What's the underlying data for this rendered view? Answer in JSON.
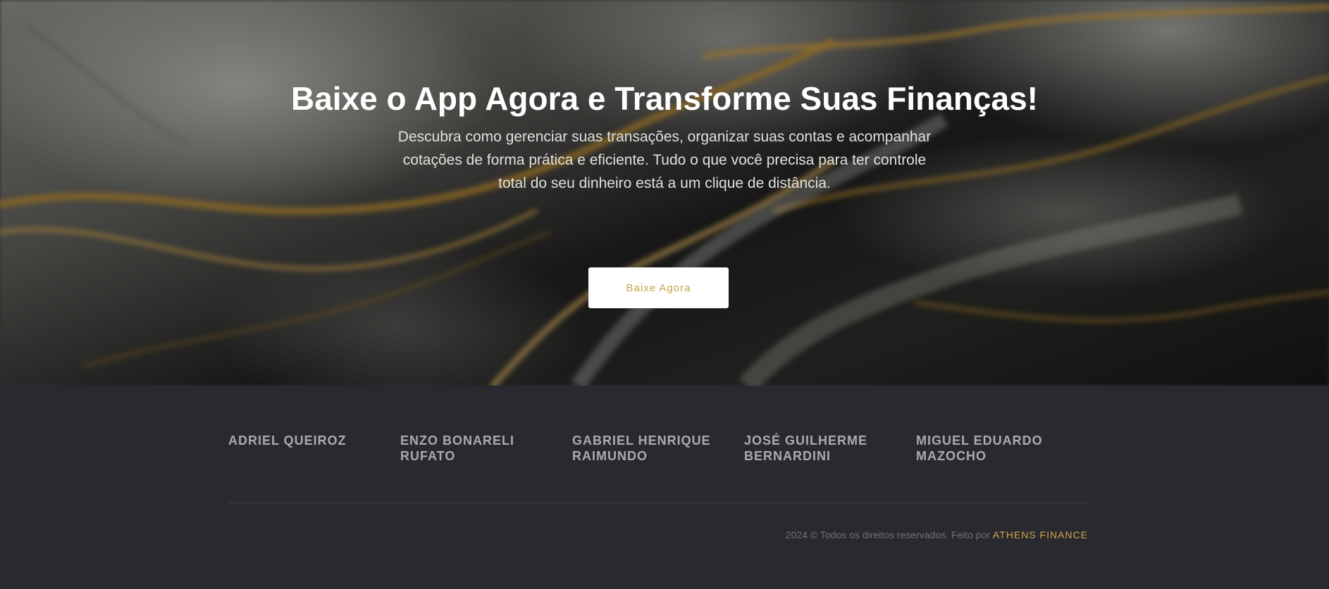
{
  "hero": {
    "title": "Baixe o App Agora e Transforme Suas Finanças!",
    "subtitle": "Descubra como gerenciar suas transações, organizar suas contas e acompanhar cotações de forma prática e eficiente. Tudo o que você precisa para ter controle total do seu dinheiro está a um clique de distância.",
    "button_label": "Baixe Agora",
    "colors": {
      "title": "#ffffff",
      "button_text": "#c9a24a",
      "button_bg": "#ffffff"
    }
  },
  "footer": {
    "team": [
      "ADRIEL QUEIROZ",
      "ENZO BONARELI RUFATO",
      "GABRIEL HENRIQUE RAIMUNDO",
      "JOSÉ GUILHERME BERNARDINI",
      "MIGUEL EDUARDO MAZOCHO"
    ],
    "copyright_text": "2024 © Todos os direitos reservados. Feito por",
    "brand_link": "ATHENS FINANCE",
    "colors": {
      "background": "#282a2f",
      "brand": "#d4a64a"
    }
  }
}
